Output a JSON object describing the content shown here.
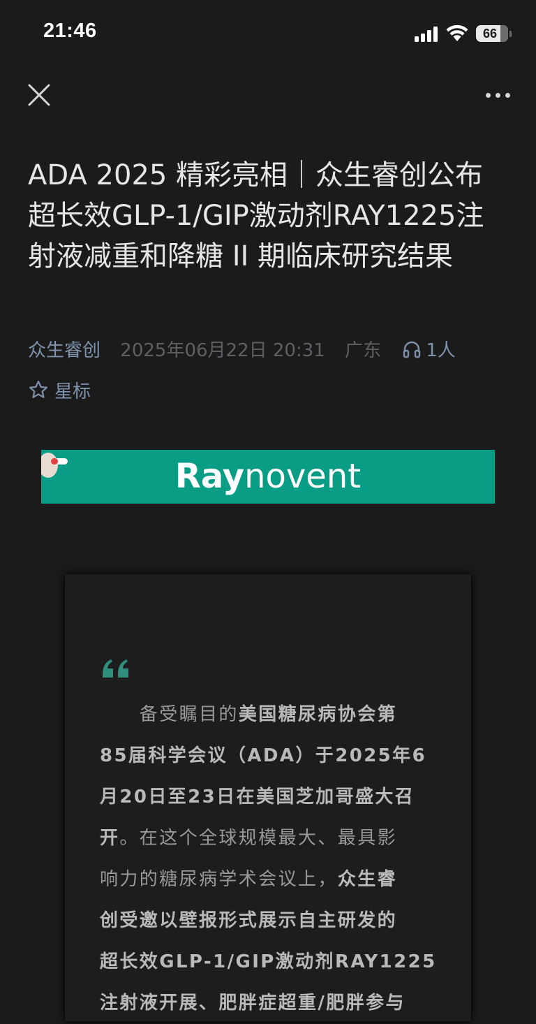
{
  "status_bar": {
    "time": "21:46",
    "battery_level": "66"
  },
  "nav": {
    "close_icon": "close-icon",
    "more_icon": "more-horizontal-icon"
  },
  "article": {
    "title": "ADA 2025 精彩亮相｜众生睿创公布超长效GLP-1/GIP激动剂RAY1225注射液减重和降糖 II 期临床研究结果",
    "author": "众生睿创",
    "date": "2025年06月22日  20:31",
    "location": "广东",
    "listen_count": "1人",
    "star_label": "星标"
  },
  "banner": {
    "logo_bold": "Ray",
    "logo_light": "novent",
    "background": "#0a9d86"
  },
  "quote": {
    "lines": [
      [
        {
          "t": "　　备受瞩目的",
          "b": false
        },
        {
          "t": "美国糖尿病协会第",
          "b": true
        }
      ],
      [
        {
          "t": "85届科学会议（ADA）于2025年6",
          "b": true
        }
      ],
      [
        {
          "t": "月20日至23日在美国芝加哥盛大召",
          "b": true
        }
      ],
      [
        {
          "t": "开",
          "b": true
        },
        {
          "t": "。在这个全球规模最大、最具影",
          "b": false
        }
      ],
      [
        {
          "t": "响力的糖尿病学术会议上，",
          "b": false
        },
        {
          "t": "众生睿",
          "b": true
        }
      ],
      [
        {
          "t": "创受邀以壁报形式展示自主研发的",
          "b": true
        }
      ],
      [
        {
          "t": "超长效GLP-1/GIP激动剂RAY1225",
          "b": true
        }
      ],
      [
        {
          "t": "注射液开展、肥胖症超重/肥胖参与",
          "b": true
        }
      ]
    ]
  },
  "colors": {
    "background": "#1b1b1c",
    "link": "#7f93ad",
    "accent": "#0a9d86"
  }
}
